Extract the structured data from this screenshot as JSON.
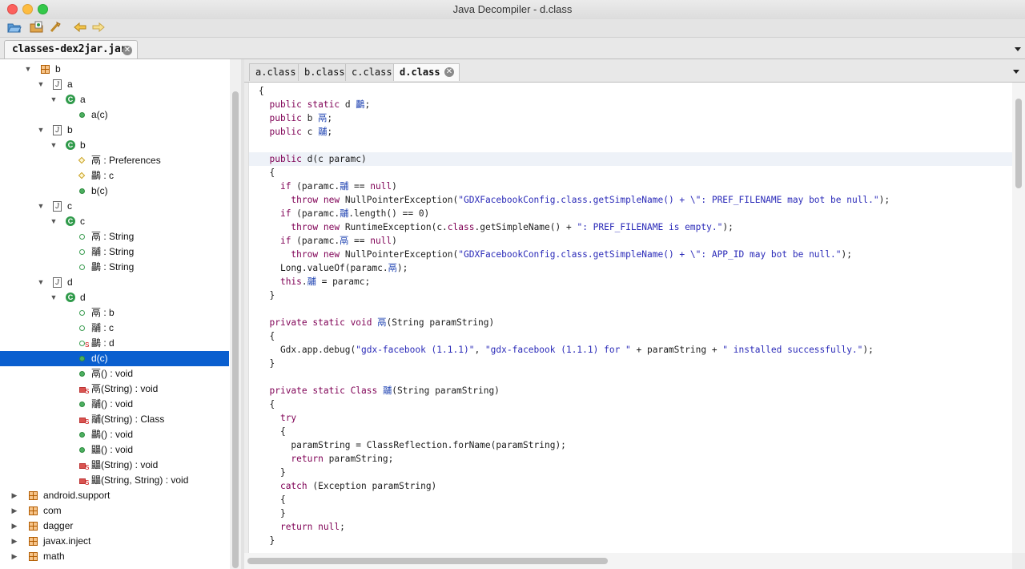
{
  "window": {
    "title": "Java Decompiler - d.class"
  },
  "toolbar": {
    "buttons": [
      "open-file",
      "open-folder",
      "search",
      "back",
      "forward"
    ]
  },
  "file_tab": {
    "label": "classes-dex2jar.jar"
  },
  "tree": {
    "rows": [
      {
        "depth": 0,
        "toggle": "open",
        "icon": "package-icon",
        "label": "b"
      },
      {
        "depth": 1,
        "toggle": "open",
        "icon": "java-file-icon",
        "label": "a"
      },
      {
        "depth": 2,
        "toggle": "open",
        "icon": "class-icon",
        "label": "a"
      },
      {
        "depth": 3,
        "toggle": "",
        "icon": "method-icon",
        "label": "a(c)"
      },
      {
        "depth": 1,
        "toggle": "open",
        "icon": "java-file-icon",
        "label": "b"
      },
      {
        "depth": 2,
        "toggle": "open",
        "icon": "class-icon",
        "label": "b"
      },
      {
        "depth": 3,
        "toggle": "",
        "icon": "field-diamond-icon",
        "label": "鬲 : Preferences"
      },
      {
        "depth": 3,
        "toggle": "",
        "icon": "field-diamond-icon",
        "label": "鸓 : c"
      },
      {
        "depth": 3,
        "toggle": "",
        "icon": "method-icon",
        "label": "b(c)"
      },
      {
        "depth": 1,
        "toggle": "open",
        "icon": "java-file-icon",
        "label": "c"
      },
      {
        "depth": 2,
        "toggle": "open",
        "icon": "class-icon",
        "label": "c"
      },
      {
        "depth": 3,
        "toggle": "",
        "icon": "field-icon",
        "label": "鬲 : String"
      },
      {
        "depth": 3,
        "toggle": "",
        "icon": "field-icon",
        "label": "鬴 : String"
      },
      {
        "depth": 3,
        "toggle": "",
        "icon": "field-icon",
        "label": "鸓 : String"
      },
      {
        "depth": 1,
        "toggle": "open",
        "icon": "java-file-icon",
        "label": "d"
      },
      {
        "depth": 2,
        "toggle": "open",
        "icon": "class-icon",
        "label": "d"
      },
      {
        "depth": 3,
        "toggle": "",
        "icon": "field-icon",
        "label": "鬲 : b"
      },
      {
        "depth": 3,
        "toggle": "",
        "icon": "field-icon",
        "label": "鬴 : c"
      },
      {
        "depth": 3,
        "toggle": "",
        "icon": "static-field-icon",
        "label": "鸓 : d"
      },
      {
        "depth": 3,
        "toggle": "",
        "icon": "constructor-icon",
        "label": "d(c)",
        "selected": true
      },
      {
        "depth": 3,
        "toggle": "",
        "icon": "method-icon",
        "label": "鬲() : void"
      },
      {
        "depth": 3,
        "toggle": "",
        "icon": "private-static-method-icon",
        "label": "鬲(String) : void"
      },
      {
        "depth": 3,
        "toggle": "",
        "icon": "method-icon",
        "label": "鬴() : void"
      },
      {
        "depth": 3,
        "toggle": "",
        "icon": "private-static-method-icon",
        "label": "鬴(String) : Class"
      },
      {
        "depth": 3,
        "toggle": "",
        "icon": "method-icon",
        "label": "鸓() : void"
      },
      {
        "depth": 3,
        "toggle": "",
        "icon": "method-icon",
        "label": "鼺() : void"
      },
      {
        "depth": 3,
        "toggle": "",
        "icon": "private-static-method-icon",
        "label": "鼺(String) : void"
      },
      {
        "depth": 3,
        "toggle": "",
        "icon": "private-static-method-icon",
        "label": "鼺(String, String) : void"
      },
      {
        "depth": 0,
        "toggle": "closed",
        "icon": "package-icon",
        "label": "android.support"
      },
      {
        "depth": 0,
        "toggle": "closed",
        "icon": "package-icon",
        "label": "com"
      },
      {
        "depth": 0,
        "toggle": "closed",
        "icon": "package-icon",
        "label": "dagger"
      },
      {
        "depth": 0,
        "toggle": "closed",
        "icon": "package-icon",
        "label": "javax.inject"
      },
      {
        "depth": 0,
        "toggle": "closed",
        "icon": "package-icon",
        "label": "math"
      }
    ]
  },
  "editor": {
    "tabs": [
      {
        "label": "a.class",
        "active": false
      },
      {
        "label": "b.class",
        "active": false
      },
      {
        "label": "c.class",
        "active": false
      },
      {
        "label": "d.class",
        "active": true
      }
    ],
    "code": [
      "{",
      "  public static d 鸓;",
      "  public b 鬲;",
      "  public c 鬴;",
      "",
      "  public d(c paramc)",
      "  {",
      "    if (paramc.鬴 == null)",
      "      throw new NullPointerException(\"GDXFacebookConfig.class.getSimpleName() + \\\": PREF_FILENAME may bot be null.\");",
      "    if (paramc.鬴.length() == 0)",
      "      throw new RuntimeException(c.class.getSimpleName() + \": PREF_FILENAME is empty.\");",
      "    if (paramc.鬲 == null)",
      "      throw new NullPointerException(\"GDXFacebookConfig.class.getSimpleName() + \\\": APP_ID may bot be null.\");",
      "    Long.valueOf(paramc.鬲);",
      "    this.鬴 = paramc;",
      "  }",
      "",
      "  private static void 鬲(String paramString)",
      "  {",
      "    Gdx.app.debug(\"gdx-facebook (1.1.1)\", \"gdx-facebook (1.1.1) for \" + paramString + \" installed successfully.\");",
      "  }",
      "",
      "  private static Class 鬴(String paramString)",
      "  {",
      "    try",
      "    {",
      "      paramString = ClassReflection.forName(paramString);",
      "      return paramString;",
      "    }",
      "    catch (Exception paramString)",
      "    {",
      "    }",
      "    return null;",
      "  }"
    ],
    "highlighted_line": 5
  }
}
